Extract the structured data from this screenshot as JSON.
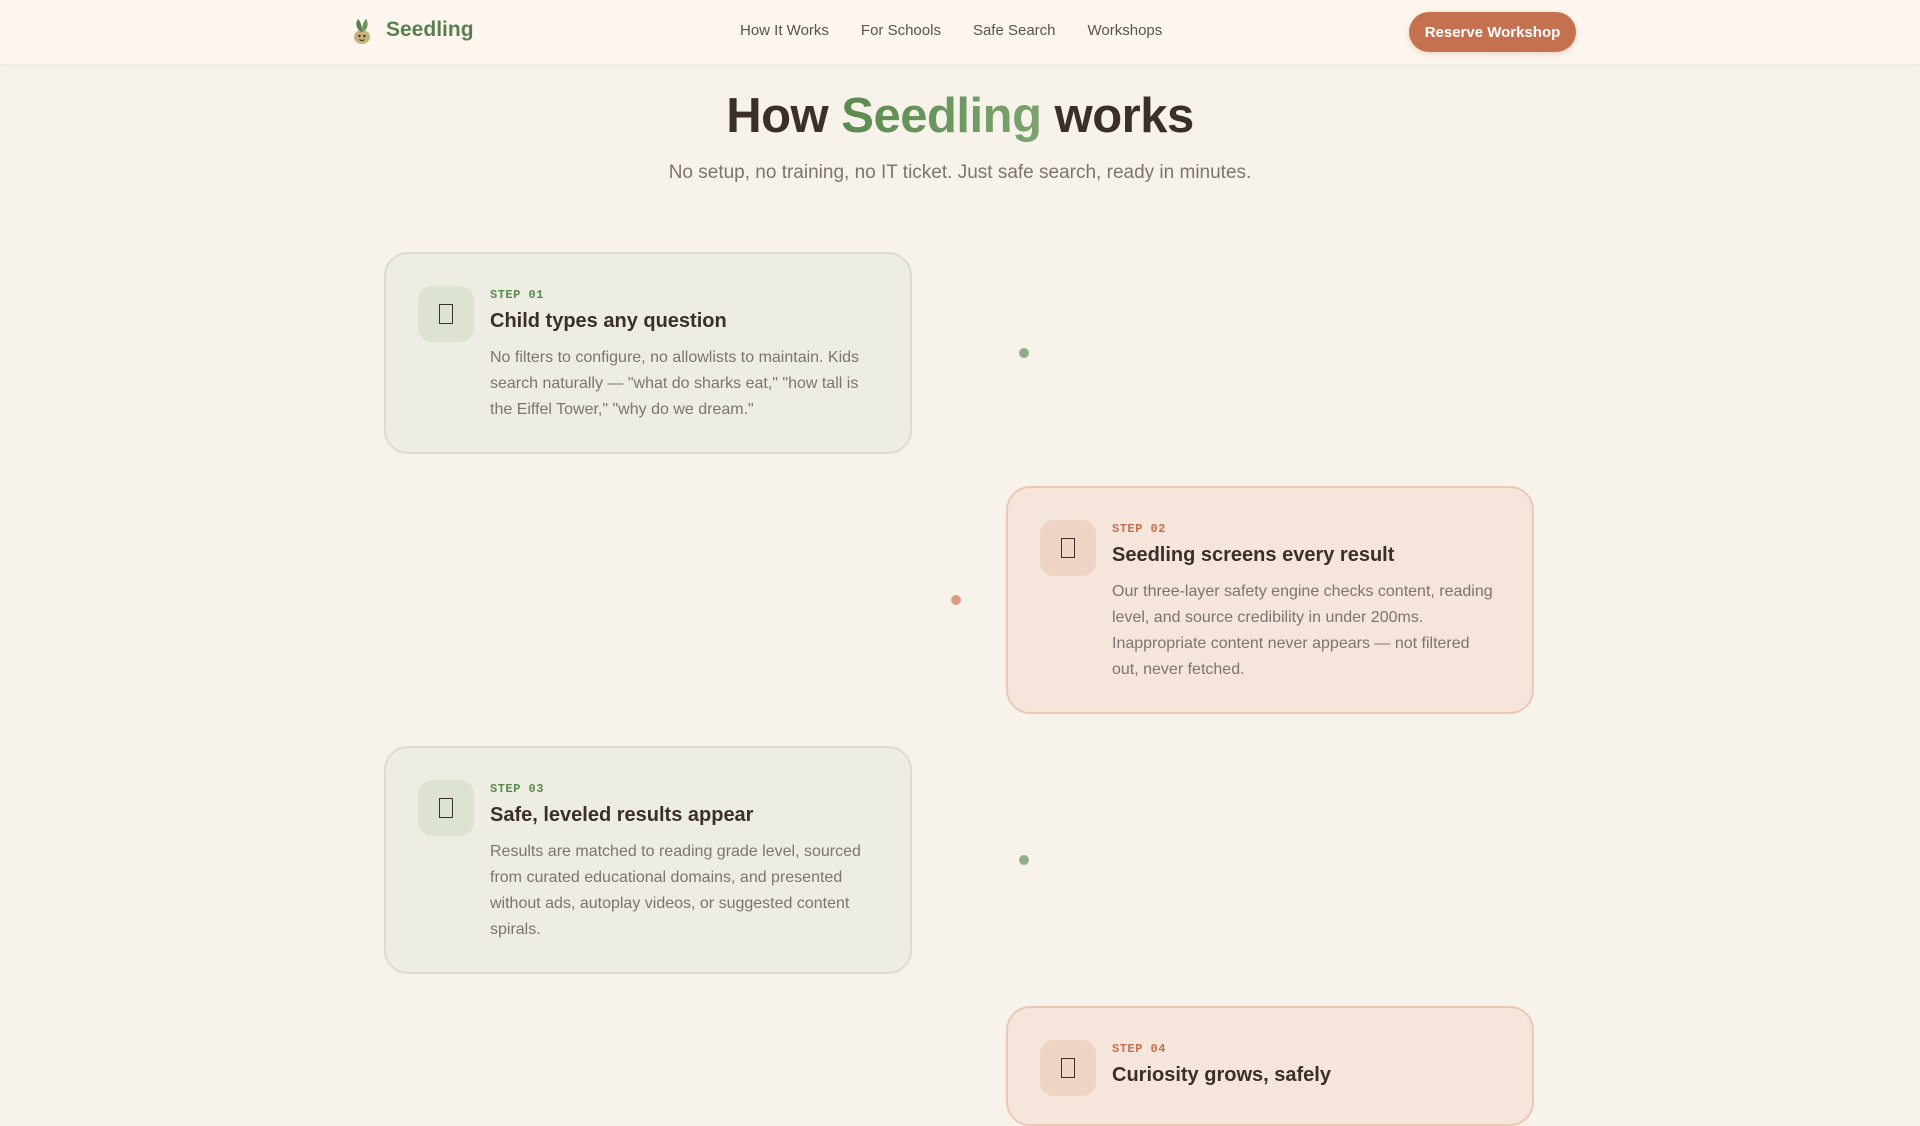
{
  "header": {
    "brand": "Seedling",
    "nav": [
      {
        "label": "How It Works"
      },
      {
        "label": "For Schools"
      },
      {
        "label": "Safe Search"
      },
      {
        "label": "Workshops"
      }
    ],
    "cta_label": "Reserve Workshop"
  },
  "hero": {
    "title_pre": "How",
    "title_accent": "Seedling",
    "title_post": "works",
    "subtitle": "No setup, no training, no IT ticket. Just safe search, ready in minutes."
  },
  "steps": [
    {
      "label": "STEP 01",
      "title": "Child types any question",
      "description": "No filters to configure, no allowlists to maintain. Kids search naturally — \"what do sharks eat,\" \"how tall is the Eiffel Tower,\" \"why do we dream.\""
    },
    {
      "label": "STEP 02",
      "title": "Seedling screens every result",
      "description": "Our three-layer safety engine checks content, reading level, and source credibility in under 200ms. Inappropriate content never appears — not filtered out, never fetched."
    },
    {
      "label": "STEP 03",
      "title": "Safe, leveled results appear",
      "description": "Results are matched to reading grade level, sourced from curated educational domains, and presented without ads, autoplay videos, or suggested content spirals."
    },
    {
      "label": "STEP 04",
      "title": "Curiosity grows, safely",
      "description": ""
    }
  ],
  "colors": {
    "brand_green": "#5a7f4f",
    "accent_terracotta": "#c5704f",
    "background": "#f7f3ea"
  }
}
